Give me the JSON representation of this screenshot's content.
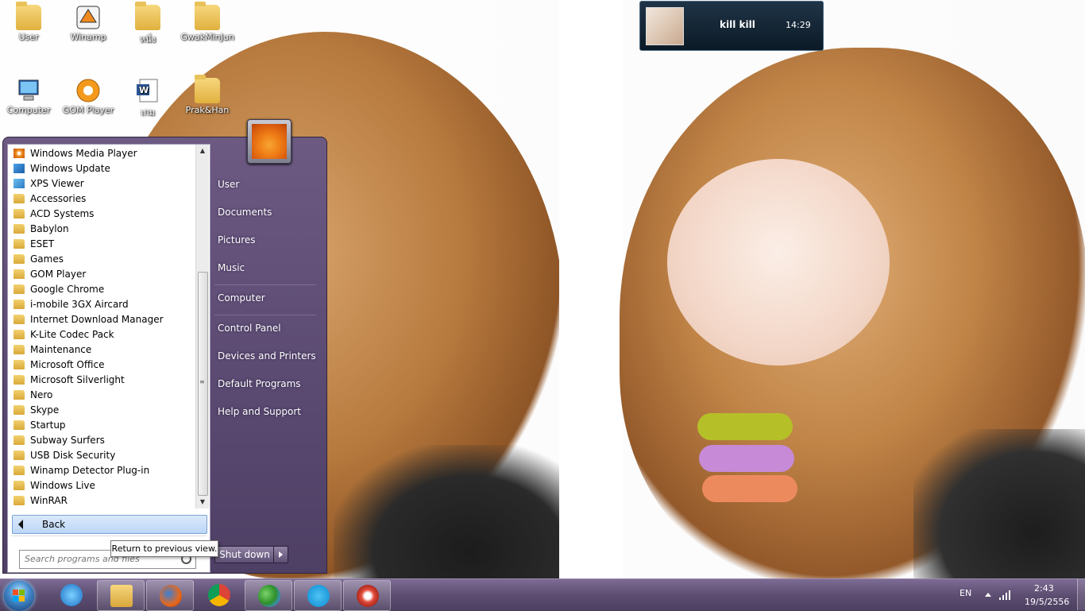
{
  "desktop_icons": [
    {
      "label": "User",
      "icon": "folder-user-icon"
    },
    {
      "label": "Winamp",
      "icon": "winamp-shortcut-icon"
    },
    {
      "label": "หนึ่ง",
      "icon": "folder-icon"
    },
    {
      "label": "GwakMinJun",
      "icon": "folder-icon"
    },
    {
      "label": "Computer",
      "icon": "computer-icon"
    },
    {
      "label": "GOM Player",
      "icon": "gom-player-icon"
    },
    {
      "label": "เกม",
      "icon": "word-document-icon"
    },
    {
      "label": "Prak&Han",
      "icon": "folder-icon"
    }
  ],
  "notification": {
    "title": "kill kill",
    "time": "14:29"
  },
  "start_menu": {
    "programs": [
      {
        "label": "Windows Media Player",
        "icon": "media-player-icon"
      },
      {
        "label": "Windows Update",
        "icon": "windows-update-icon"
      },
      {
        "label": "XPS Viewer",
        "icon": "xps-viewer-icon"
      },
      {
        "label": "Accessories",
        "icon": "folder-icon"
      },
      {
        "label": "ACD Systems",
        "icon": "folder-icon"
      },
      {
        "label": "Babylon",
        "icon": "folder-icon"
      },
      {
        "label": "ESET",
        "icon": "folder-icon"
      },
      {
        "label": "Games",
        "icon": "folder-icon"
      },
      {
        "label": "GOM Player",
        "icon": "folder-icon"
      },
      {
        "label": "Google Chrome",
        "icon": "folder-icon"
      },
      {
        "label": "i-mobile 3GX Aircard",
        "icon": "folder-icon"
      },
      {
        "label": "Internet Download Manager",
        "icon": "folder-icon"
      },
      {
        "label": "K-Lite Codec Pack",
        "icon": "folder-icon"
      },
      {
        "label": "Maintenance",
        "icon": "folder-icon"
      },
      {
        "label": "Microsoft Office",
        "icon": "folder-icon"
      },
      {
        "label": "Microsoft Silverlight",
        "icon": "folder-icon"
      },
      {
        "label": "Nero",
        "icon": "folder-icon"
      },
      {
        "label": "Skype",
        "icon": "folder-icon"
      },
      {
        "label": "Startup",
        "icon": "folder-icon"
      },
      {
        "label": "Subway Surfers",
        "icon": "folder-icon"
      },
      {
        "label": "USB Disk Security",
        "icon": "folder-icon"
      },
      {
        "label": "Winamp Detector Plug-in",
        "icon": "folder-icon"
      },
      {
        "label": "Windows Live",
        "icon": "folder-icon"
      },
      {
        "label": "WinRAR",
        "icon": "folder-icon"
      }
    ],
    "back_label": "Back",
    "search_placeholder": "Search programs and files",
    "tooltip": "Return to previous view.",
    "right_items": [
      {
        "label": "User"
      },
      {
        "label": "Documents"
      },
      {
        "label": "Pictures"
      },
      {
        "label": "Music"
      },
      {
        "label": "Computer"
      },
      {
        "label": "Control Panel"
      },
      {
        "label": "Devices and Printers"
      },
      {
        "label": "Default Programs"
      },
      {
        "label": "Help and Support"
      }
    ],
    "shutdown_label": "Shut down"
  },
  "taskbar": {
    "pinned": [
      {
        "name": "internet-explorer-icon"
      },
      {
        "name": "windows-explorer-icon"
      },
      {
        "name": "firefox-icon"
      },
      {
        "name": "chrome-icon"
      },
      {
        "name": "messenger-icon"
      },
      {
        "name": "skype-icon"
      },
      {
        "name": "media-app-icon"
      }
    ],
    "language": "EN",
    "time": "2:43",
    "date": "19/5/2556"
  },
  "colors": {
    "taskbar": "#5d4e72",
    "start_menu": "#5b4a72",
    "back_button": "#bcd6f6"
  }
}
